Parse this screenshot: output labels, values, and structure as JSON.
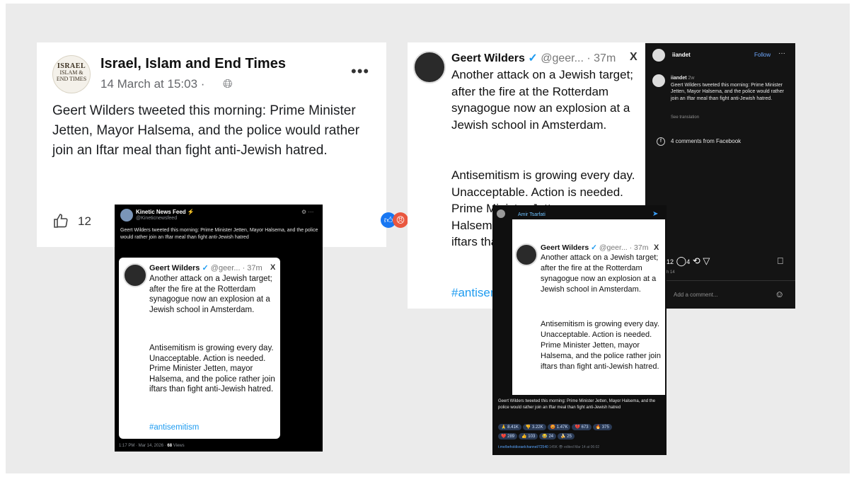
{
  "facebook": {
    "logo_lines": [
      "ISRAEL",
      "ISLAM &",
      "END TIMES"
    ],
    "page_name": "Israel, Islam and End Times",
    "date": "14 March at 15:03 ·",
    "more": "•••",
    "body": "Geert Wilders tweeted this morning: Prime Minister Jetten, Mayor Halsema, and the police would rather join an Iftar meal than fight anti-Jewish hatred.",
    "like_count": "12"
  },
  "wilders_tweet": {
    "name": "Geert Wilders",
    "handle": "@geer... · 37m",
    "p1": "Another attack on a Jewish target; after the fire at the Rotterdam synagogue now an explosion at a Jewish school in Amsterdam.",
    "p2": "Antisemitism is growing every day. Unacceptable. Action is needed. Prime Minister Jetten, mayor Halsema, and the police rather join iftars than fight anti-Jewish hatred.",
    "p2_short": "Antisemitism is growing every day. Unacceptable. Action is needed. Prime Minister Jetten, mayor Halsema, and the police rather join iftars than fight anti-Jewish hatred.",
    "hashtag": "#antisemitism",
    "big_p2_visible": "Antisemitism is growing every day. Unacceptable. Action is needed. Prime Minister Jetten, mayor Halsema, and the police rather join iftars than fight anti-Jewish hatred.",
    "x_logo": "X"
  },
  "kinetic": {
    "name": "Kinetic News Feed ⚡",
    "handle": "@Kineticnewsfeed",
    "text": "Geert Wilders tweeted this morning: Prime Minister Jetten, Mayor Halsema, and the police would rather join an Iftar meal than fight anti-Jewish hatred",
    "footer_time": "1:17 PM · Mar 14, 2026 ·",
    "footer_views": "68",
    "footer_views_label": "Views"
  },
  "instagram": {
    "username": "iiandet",
    "follow": "Follow",
    "caption_user": "iiandet",
    "caption_time": "2w",
    "caption": "Geert Wilders tweeted this morning: Prime Minister Jetten, Mayor Halsema, and the police would rather join an Iftar meal than fight anti-Jewish hatred.",
    "see_translation": "See translation",
    "comments": "4 comments from Facebook",
    "actions_counts": "12",
    "actions_counts2": "4",
    "date": "h 14",
    "add_comment": "Add a comment..."
  },
  "telegram": {
    "name": "Amir Tsarfati",
    "text": "Geert Wilders tweeted this morning: Prime Minister Jetten, Mayor Halsema, and the police would rather join an Iftar meal than fight anti-Jewish hatred",
    "reactions": [
      "🙏 8.41K",
      "👎 3.22K",
      "😡 1.47K",
      "💔 673",
      "🔥 375",
      "❤️ 289",
      "👍 103",
      "😂 24",
      "🍌 25"
    ],
    "link": "t.me/beholdisraelchannel/72540",
    "views": "145K",
    "edited": "edited Mar 14 at 06:02"
  }
}
